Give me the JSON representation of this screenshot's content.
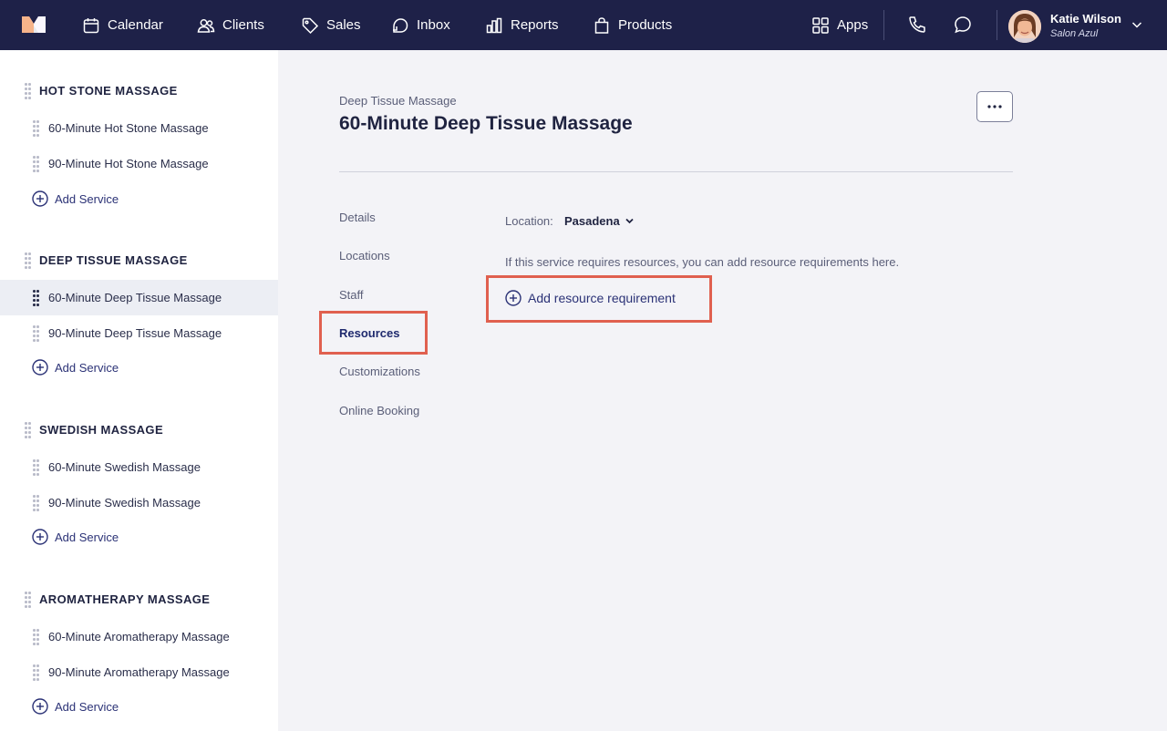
{
  "nav": {
    "items": [
      {
        "label": "Calendar",
        "icon": "calendar-icon"
      },
      {
        "label": "Clients",
        "icon": "clients-icon"
      },
      {
        "label": "Sales",
        "icon": "tag-icon"
      },
      {
        "label": "Inbox",
        "icon": "inbox-icon"
      },
      {
        "label": "Reports",
        "icon": "bar-chart-icon"
      },
      {
        "label": "Products",
        "icon": "shopping-bag-icon"
      }
    ],
    "apps_label": "Apps",
    "user": {
      "name": "Katie Wilson",
      "salon": "Salon Azul"
    }
  },
  "sidebar": {
    "groups": [
      {
        "title": "HOT STONE MASSAGE",
        "services": [
          "60-Minute Hot Stone Massage",
          "90-Minute Hot Stone Massage"
        ],
        "add_label": "Add Service"
      },
      {
        "title": "DEEP TISSUE MASSAGE",
        "services": [
          "60-Minute Deep Tissue Massage",
          "90-Minute Deep Tissue Massage"
        ],
        "add_label": "Add Service"
      },
      {
        "title": "SWEDISH MASSAGE",
        "services": [
          "60-Minute Swedish Massage",
          "90-Minute Swedish Massage"
        ],
        "add_label": "Add Service"
      },
      {
        "title": "AROMATHERAPY MASSAGE",
        "services": [
          "60-Minute Aromatherapy Massage",
          "90-Minute Aromatherapy Massage"
        ],
        "add_label": "Add Service"
      }
    ],
    "active_service": "60-Minute Deep Tissue Massage"
  },
  "main": {
    "breadcrumb": "Deep Tissue Massage",
    "title": "60-Minute Deep Tissue Massage",
    "tabs": [
      "Details",
      "Locations",
      "Staff",
      "Resources",
      "Customizations",
      "Online Booking"
    ],
    "active_tab": "Resources",
    "location_label": "Location:",
    "location_value": "Pasadena",
    "info_text": "If this service requires resources, you can add resource requirements here.",
    "add_resource_label": "Add resource requirement"
  },
  "colors": {
    "nav_bg": "#1e2148",
    "accent": "#2b3276",
    "highlight": "#e0604f"
  }
}
